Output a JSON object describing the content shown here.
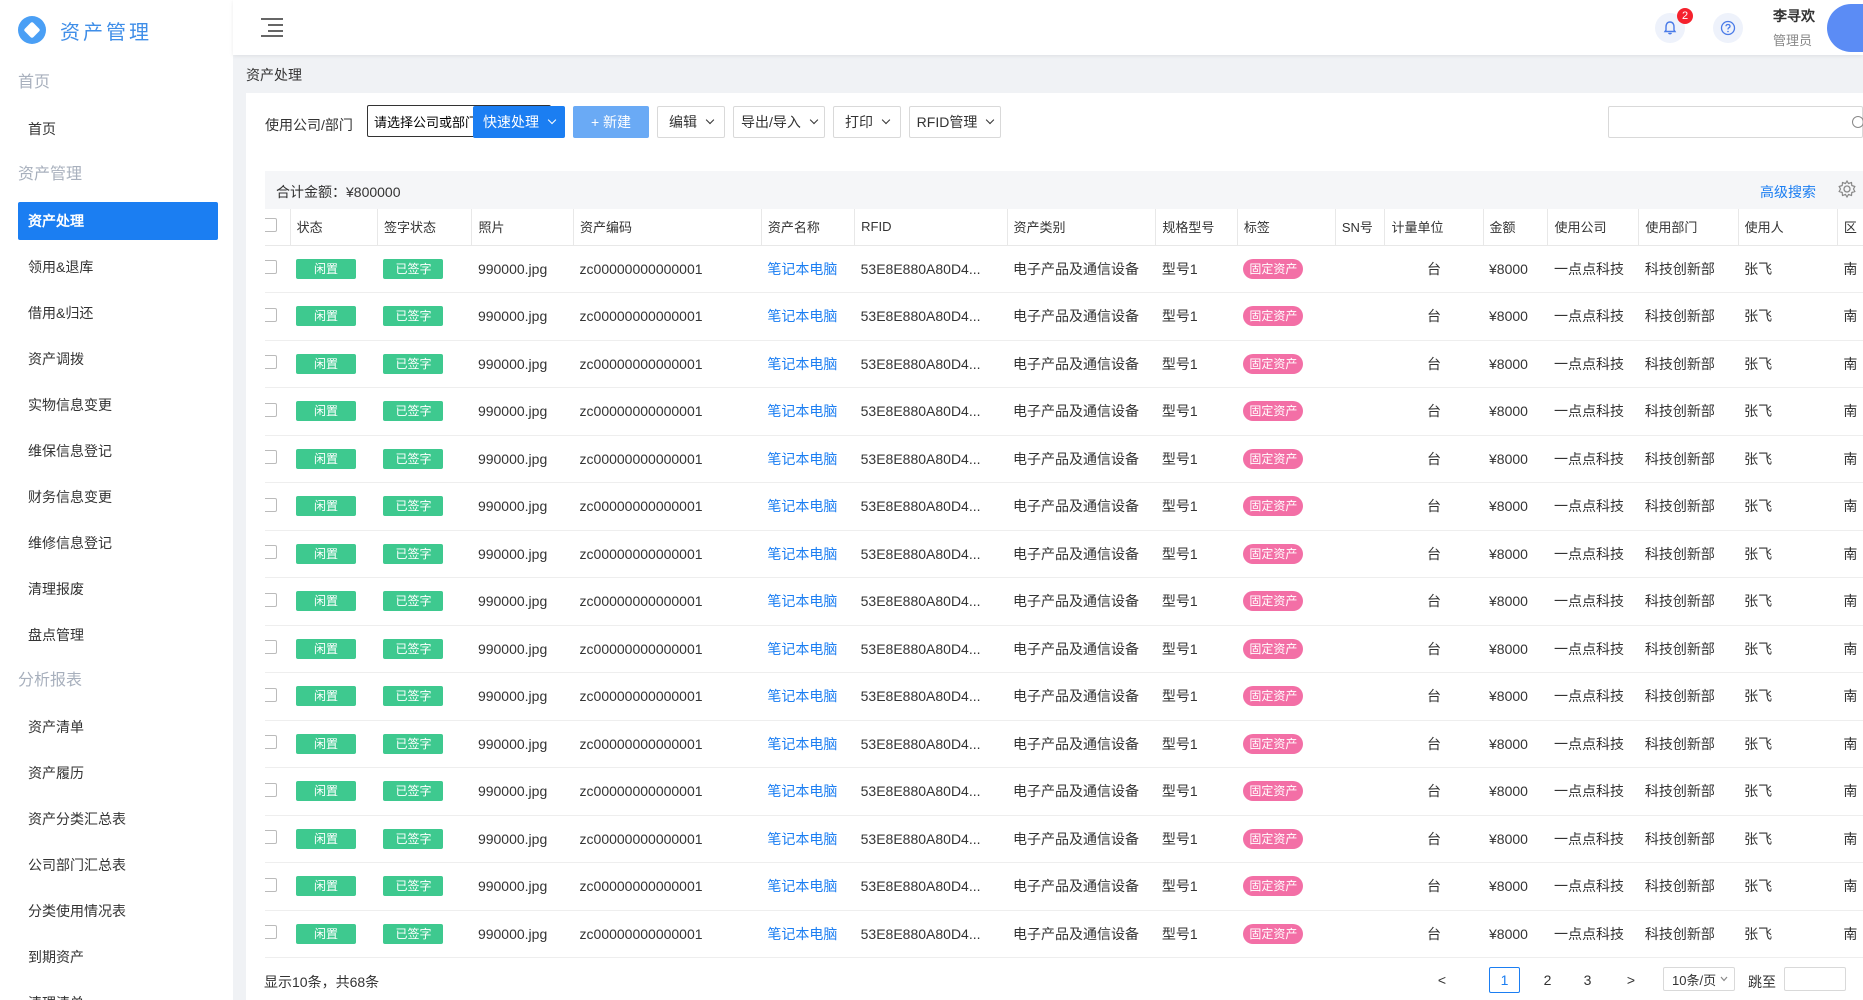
{
  "app": {
    "title": "资产管理"
  },
  "sidebar": {
    "groups": [
      {
        "label": "首页",
        "items": [
          "首页"
        ]
      },
      {
        "label": "资产管理",
        "items": [
          "资产处理",
          "领用&退库",
          "借用&归还",
          "资产调拨",
          "实物信息变更",
          "维保信息登记",
          "财务信息变更",
          "维修信息登记",
          "清理报废",
          "盘点管理"
        ]
      },
      {
        "label": "分析报表",
        "items": [
          "资产清单",
          "资产履历",
          "资产分类汇总表",
          "公司部门汇总表",
          "分类使用情况表",
          "到期资产",
          "清理清单"
        ]
      }
    ],
    "active": "资产处理"
  },
  "header": {
    "notification_count": "2",
    "user_name": "李寻欢",
    "user_role": "管理员"
  },
  "breadcrumb": "资产处理",
  "toolbar": {
    "company_label": "使用公司/部门",
    "company_select": "请选择公司或部门",
    "quick_label": "快速处理",
    "new_label": "+ 新建",
    "edit_label": "编辑",
    "export_label": "导出/导入",
    "print_label": "打印",
    "rfid_label": "RFID管理",
    "search_placeholder": ""
  },
  "summary": {
    "total": "合计金额：¥800000",
    "advanced_search": "高级搜索"
  },
  "table": {
    "columns": [
      "状态",
      "签字状态",
      "照片",
      "资产编码",
      "资产名称",
      "RFID",
      "资产类别",
      "规格型号",
      "标签",
      "SN号",
      "计量单位",
      "金额",
      "使用公司",
      "使用部门",
      "使用人",
      "区"
    ],
    "rows": [
      {
        "status": "闲置",
        "sign": "已签字",
        "photo": "990000.jpg",
        "code": "zc00000000000001",
        "name": "笔记本电脑",
        "rfid": "53E8E880A80D4...",
        "category": "电子产品及通信设备",
        "model": "型号1",
        "tag": "固定资产",
        "sn": "",
        "unit": "台",
        "amount": "¥8000",
        "company": "一点点科技",
        "dept": "科技创新部",
        "user": "张飞",
        "area": "南"
      },
      {
        "status": "闲置",
        "sign": "已签字",
        "photo": "990000.jpg",
        "code": "zc00000000000001",
        "name": "笔记本电脑",
        "rfid": "53E8E880A80D4...",
        "category": "电子产品及通信设备",
        "model": "型号1",
        "tag": "固定资产",
        "sn": "",
        "unit": "台",
        "amount": "¥8000",
        "company": "一点点科技",
        "dept": "科技创新部",
        "user": "张飞",
        "area": "南"
      },
      {
        "status": "闲置",
        "sign": "已签字",
        "photo": "990000.jpg",
        "code": "zc00000000000001",
        "name": "笔记本电脑",
        "rfid": "53E8E880A80D4...",
        "category": "电子产品及通信设备",
        "model": "型号1",
        "tag": "固定资产",
        "sn": "",
        "unit": "台",
        "amount": "¥8000",
        "company": "一点点科技",
        "dept": "科技创新部",
        "user": "张飞",
        "area": "南"
      },
      {
        "status": "闲置",
        "sign": "已签字",
        "photo": "990000.jpg",
        "code": "zc00000000000001",
        "name": "笔记本电脑",
        "rfid": "53E8E880A80D4...",
        "category": "电子产品及通信设备",
        "model": "型号1",
        "tag": "固定资产",
        "sn": "",
        "unit": "台",
        "amount": "¥8000",
        "company": "一点点科技",
        "dept": "科技创新部",
        "user": "张飞",
        "area": "南"
      },
      {
        "status": "闲置",
        "sign": "已签字",
        "photo": "990000.jpg",
        "code": "zc00000000000001",
        "name": "笔记本电脑",
        "rfid": "53E8E880A80D4...",
        "category": "电子产品及通信设备",
        "model": "型号1",
        "tag": "固定资产",
        "sn": "",
        "unit": "台",
        "amount": "¥8000",
        "company": "一点点科技",
        "dept": "科技创新部",
        "user": "张飞",
        "area": "南"
      },
      {
        "status": "闲置",
        "sign": "已签字",
        "photo": "990000.jpg",
        "code": "zc00000000000001",
        "name": "笔记本电脑",
        "rfid": "53E8E880A80D4...",
        "category": "电子产品及通信设备",
        "model": "型号1",
        "tag": "固定资产",
        "sn": "",
        "unit": "台",
        "amount": "¥8000",
        "company": "一点点科技",
        "dept": "科技创新部",
        "user": "张飞",
        "area": "南"
      },
      {
        "status": "闲置",
        "sign": "已签字",
        "photo": "990000.jpg",
        "code": "zc00000000000001",
        "name": "笔记本电脑",
        "rfid": "53E8E880A80D4...",
        "category": "电子产品及通信设备",
        "model": "型号1",
        "tag": "固定资产",
        "sn": "",
        "unit": "台",
        "amount": "¥8000",
        "company": "一点点科技",
        "dept": "科技创新部",
        "user": "张飞",
        "area": "南"
      },
      {
        "status": "闲置",
        "sign": "已签字",
        "photo": "990000.jpg",
        "code": "zc00000000000001",
        "name": "笔记本电脑",
        "rfid": "53E8E880A80D4...",
        "category": "电子产品及通信设备",
        "model": "型号1",
        "tag": "固定资产",
        "sn": "",
        "unit": "台",
        "amount": "¥8000",
        "company": "一点点科技",
        "dept": "科技创新部",
        "user": "张飞",
        "area": "南"
      },
      {
        "status": "闲置",
        "sign": "已签字",
        "photo": "990000.jpg",
        "code": "zc00000000000001",
        "name": "笔记本电脑",
        "rfid": "53E8E880A80D4...",
        "category": "电子产品及通信设备",
        "model": "型号1",
        "tag": "固定资产",
        "sn": "",
        "unit": "台",
        "amount": "¥8000",
        "company": "一点点科技",
        "dept": "科技创新部",
        "user": "张飞",
        "area": "南"
      },
      {
        "status": "闲置",
        "sign": "已签字",
        "photo": "990000.jpg",
        "code": "zc00000000000001",
        "name": "笔记本电脑",
        "rfid": "53E8E880A80D4...",
        "category": "电子产品及通信设备",
        "model": "型号1",
        "tag": "固定资产",
        "sn": "",
        "unit": "台",
        "amount": "¥8000",
        "company": "一点点科技",
        "dept": "科技创新部",
        "user": "张飞",
        "area": "南"
      },
      {
        "status": "闲置",
        "sign": "已签字",
        "photo": "990000.jpg",
        "code": "zc00000000000001",
        "name": "笔记本电脑",
        "rfid": "53E8E880A80D4...",
        "category": "电子产品及通信设备",
        "model": "型号1",
        "tag": "固定资产",
        "sn": "",
        "unit": "台",
        "amount": "¥8000",
        "company": "一点点科技",
        "dept": "科技创新部",
        "user": "张飞",
        "area": "南"
      },
      {
        "status": "闲置",
        "sign": "已签字",
        "photo": "990000.jpg",
        "code": "zc00000000000001",
        "name": "笔记本电脑",
        "rfid": "53E8E880A80D4...",
        "category": "电子产品及通信设备",
        "model": "型号1",
        "tag": "固定资产",
        "sn": "",
        "unit": "台",
        "amount": "¥8000",
        "company": "一点点科技",
        "dept": "科技创新部",
        "user": "张飞",
        "area": "南"
      },
      {
        "status": "闲置",
        "sign": "已签字",
        "photo": "990000.jpg",
        "code": "zc00000000000001",
        "name": "笔记本电脑",
        "rfid": "53E8E880A80D4...",
        "category": "电子产品及通信设备",
        "model": "型号1",
        "tag": "固定资产",
        "sn": "",
        "unit": "台",
        "amount": "¥8000",
        "company": "一点点科技",
        "dept": "科技创新部",
        "user": "张飞",
        "area": "南"
      },
      {
        "status": "闲置",
        "sign": "已签字",
        "photo": "990000.jpg",
        "code": "zc00000000000001",
        "name": "笔记本电脑",
        "rfid": "53E8E880A80D4...",
        "category": "电子产品及通信设备",
        "model": "型号1",
        "tag": "固定资产",
        "sn": "",
        "unit": "台",
        "amount": "¥8000",
        "company": "一点点科技",
        "dept": "科技创新部",
        "user": "张飞",
        "area": "南"
      },
      {
        "status": "闲置",
        "sign": "已签字",
        "photo": "990000.jpg",
        "code": "zc00000000000001",
        "name": "笔记本电脑",
        "rfid": "53E8E880A80D4...",
        "category": "电子产品及通信设备",
        "model": "型号1",
        "tag": "固定资产",
        "sn": "",
        "unit": "台",
        "amount": "¥8000",
        "company": "一点点科技",
        "dept": "科技创新部",
        "user": "张飞",
        "area": "南"
      }
    ]
  },
  "pagination": {
    "info": "显示10条，共68条",
    "prev": "<",
    "pages": [
      "1",
      "2",
      "3"
    ],
    "current": "1",
    "next": ">",
    "page_size": "10条/页",
    "jump_label": "跳至"
  },
  "colors": {
    "primary": "#1b7ef2",
    "status_green": "#3ec98f",
    "tag_pink": "#f36fa6"
  }
}
